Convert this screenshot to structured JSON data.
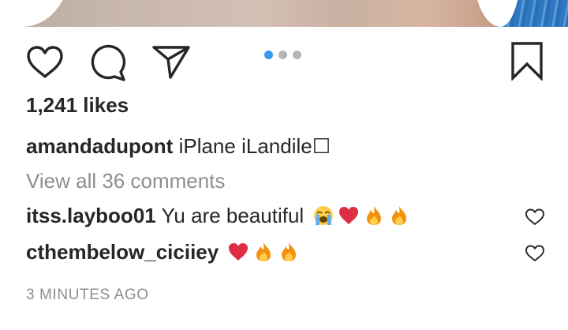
{
  "post": {
    "likes": "1,241 likes",
    "caption": {
      "username": "amandadupont",
      "text": "iPlane iLandile☐"
    },
    "view_comments": "View all 36 comments",
    "comments": [
      {
        "username": "itss.layboo01",
        "text": "Yu are beautiful",
        "emojis": [
          "loudly-crying-face",
          "red-heart",
          "fire",
          "fire"
        ]
      },
      {
        "username": "cthembelow_ciciiey",
        "text": "",
        "emojis": [
          "red-heart",
          "fire",
          "fire"
        ]
      }
    ],
    "timestamp": "3 MINUTES AGO"
  },
  "carousel": {
    "total": 3,
    "active_index": 0
  },
  "colors": {
    "accent": "#3897f0",
    "text": "#262626",
    "secondary_text": "#8e8e8e",
    "heart_red": "#e0202a",
    "fire_orange": "#f4900c"
  },
  "icons": [
    "heart-icon",
    "comment-icon",
    "share-icon",
    "bookmark-icon"
  ]
}
